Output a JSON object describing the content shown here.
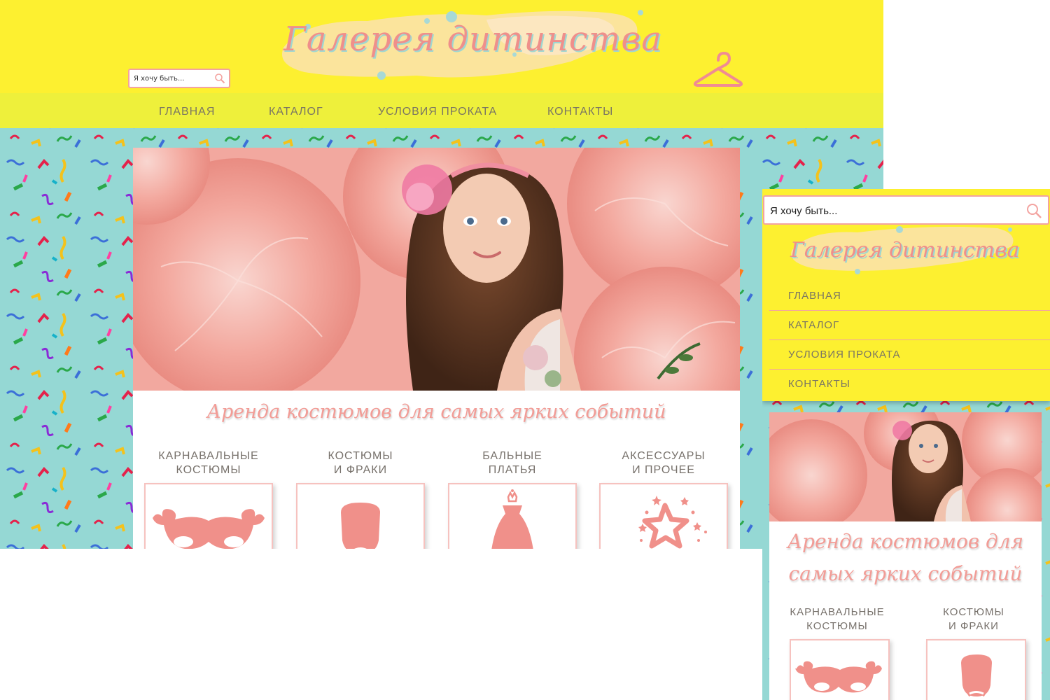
{
  "brand": {
    "logo_text": "Галерея дитинства",
    "accent_pink": "#ef8f8b",
    "header_yellow": "#fdf030",
    "nav_yellow": "#eef03b",
    "background_teal": "#95d8d4"
  },
  "search": {
    "placeholder": "Я хочу быть...",
    "icon": "search-icon"
  },
  "nav": {
    "items": [
      {
        "label": "ГЛАВНАЯ"
      },
      {
        "label": "КАТАЛОГ"
      },
      {
        "label": "УСЛОВИЯ ПРОКАТА"
      },
      {
        "label": "КОНТАКТЫ"
      }
    ]
  },
  "hero": {
    "image": "girl-with-pink-peonies-photo",
    "tagline": "Аренда костюмов для самых ярких событий"
  },
  "categories": [
    {
      "line1": "КАРНАВАЛЬНЫЕ",
      "line2": "КОСТЮМЫ",
      "icon": "carnival-mask-icon"
    },
    {
      "line1": "КОСТЮМЫ",
      "line2": "И ФРАКИ",
      "icon": "gentleman-silhouette-icon"
    },
    {
      "line1": "БАЛЬНЫЕ",
      "line2": "ПЛАТЬЯ",
      "icon": "ball-gown-icon"
    },
    {
      "line1": "АКСЕССУАРЫ",
      "line2": "И ПРОЧЕЕ",
      "icon": "stars-icon"
    }
  ]
}
